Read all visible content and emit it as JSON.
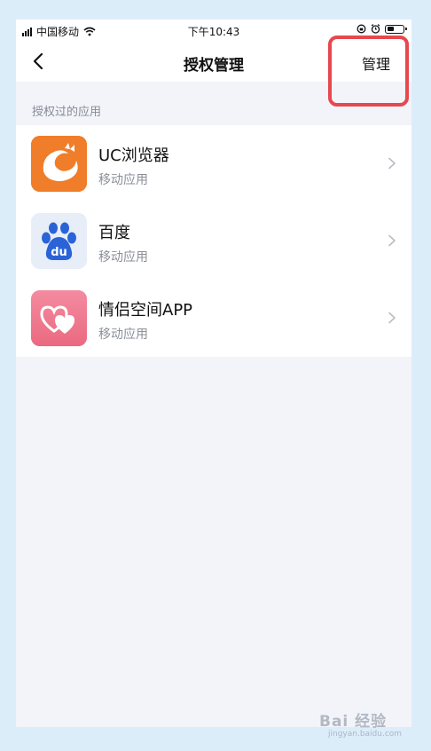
{
  "status_bar": {
    "carrier": "中国移动",
    "time": "下午10:43"
  },
  "nav": {
    "title": "授权管理",
    "action_label": "管理"
  },
  "section_label": "授权过的应用",
  "apps": [
    {
      "name": "UC浏览器",
      "subtitle": "移动应用",
      "icon": "uc-browser-icon"
    },
    {
      "name": "百度",
      "subtitle": "移动应用",
      "icon": "baidu-icon"
    },
    {
      "name": "情侣空间APP",
      "subtitle": "移动应用",
      "icon": "couple-space-icon"
    }
  ],
  "watermark": {
    "brand": "Bai 经验",
    "domain": "jingyan.baidu.com"
  },
  "colors": {
    "highlight": "#e6484e",
    "frame": "#dcedfa",
    "uc_orange": "#ef7d2a",
    "baidu_blue": "#2a63d8",
    "couple_pink": "#f07a8f"
  }
}
